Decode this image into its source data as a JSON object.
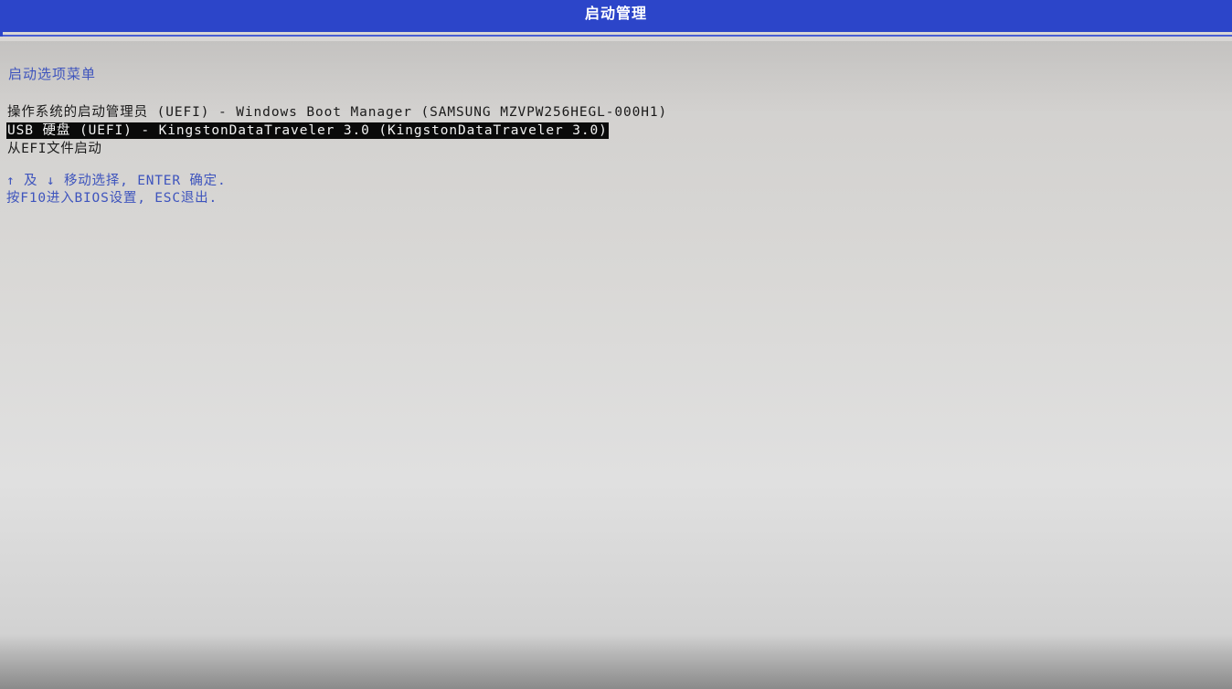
{
  "header": {
    "title": "启动管理"
  },
  "menu": {
    "heading": "启动选项菜单",
    "items": [
      {
        "label": "操作系统的启动管理员 (UEFI) - Windows Boot Manager (SAMSUNG MZVPW256HEGL-000H1)",
        "selected": false
      },
      {
        "label": "USB 硬盘 (UEFI) - KingstonDataTraveler 3.0 (KingstonDataTraveler 3.0)",
        "selected": true
      },
      {
        "label": "从EFI文件启动",
        "selected": false
      }
    ]
  },
  "hints": {
    "navigate": "↑ 及 ↓ 移动选择, ENTER 确定.",
    "bios": "按F10进入BIOS设置, ESC退出."
  },
  "colors": {
    "title_bar": "#2c45c9",
    "accent_text": "#3e54bd",
    "selection_bg": "#0a0a0a",
    "screen_bg": "#d9d8d6"
  }
}
